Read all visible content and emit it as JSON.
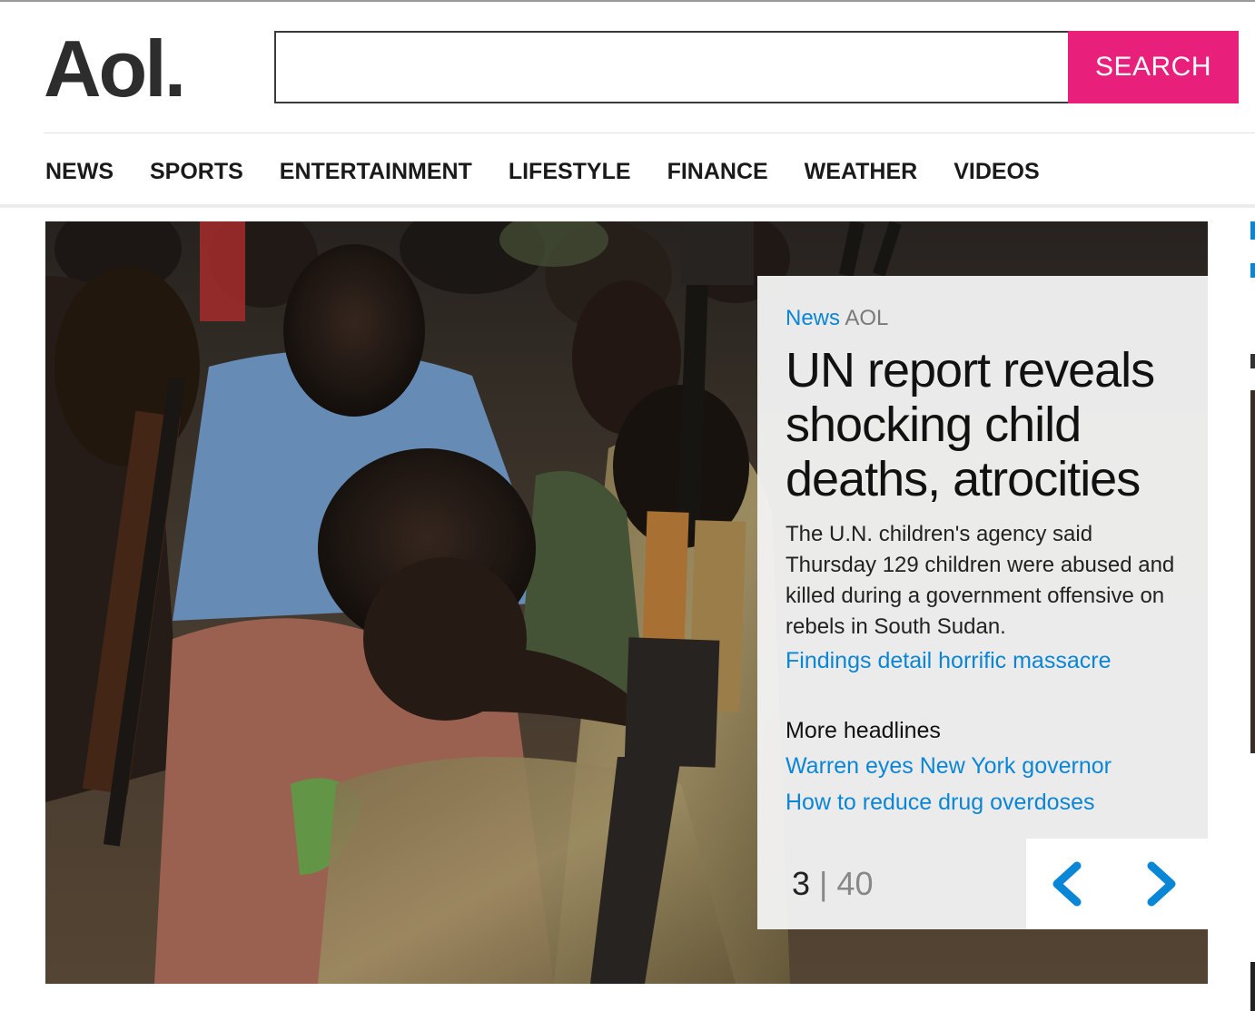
{
  "brand": {
    "logo_text": "Aol."
  },
  "search": {
    "placeholder": "",
    "value": "",
    "button_label": "SEARCH"
  },
  "nav": {
    "items": [
      {
        "label": "NEWS"
      },
      {
        "label": "SPORTS"
      },
      {
        "label": "ENTERTAINMENT"
      },
      {
        "label": "LIFESTYLE"
      },
      {
        "label": "FINANCE"
      },
      {
        "label": "WEATHER"
      },
      {
        "label": "VIDEOS"
      }
    ]
  },
  "feature": {
    "category": "News",
    "source": "AOL",
    "headline": "UN report reveals shocking child deaths, atrocities",
    "summary": "The U.N. children's agency said Thursday 129 children were abused and killed during a government offensive on rebels in South Sudan.",
    "link": "Findings detail horrific massacre",
    "more_heading": "More headlines",
    "more_links": [
      {
        "label": "Warren eyes New York governor"
      },
      {
        "label": "How to reduce drug overdoses"
      }
    ],
    "current": "3",
    "separator": "|",
    "total": "40",
    "image_alt": "Child soldiers seated with rifles in South Sudan"
  },
  "colors": {
    "accent_pink": "#e8207c",
    "link_blue": "#0a86d6",
    "logo_dark": "#2d2d2d"
  },
  "icons": {
    "prev": "chevron-left-icon",
    "next": "chevron-right-icon"
  }
}
